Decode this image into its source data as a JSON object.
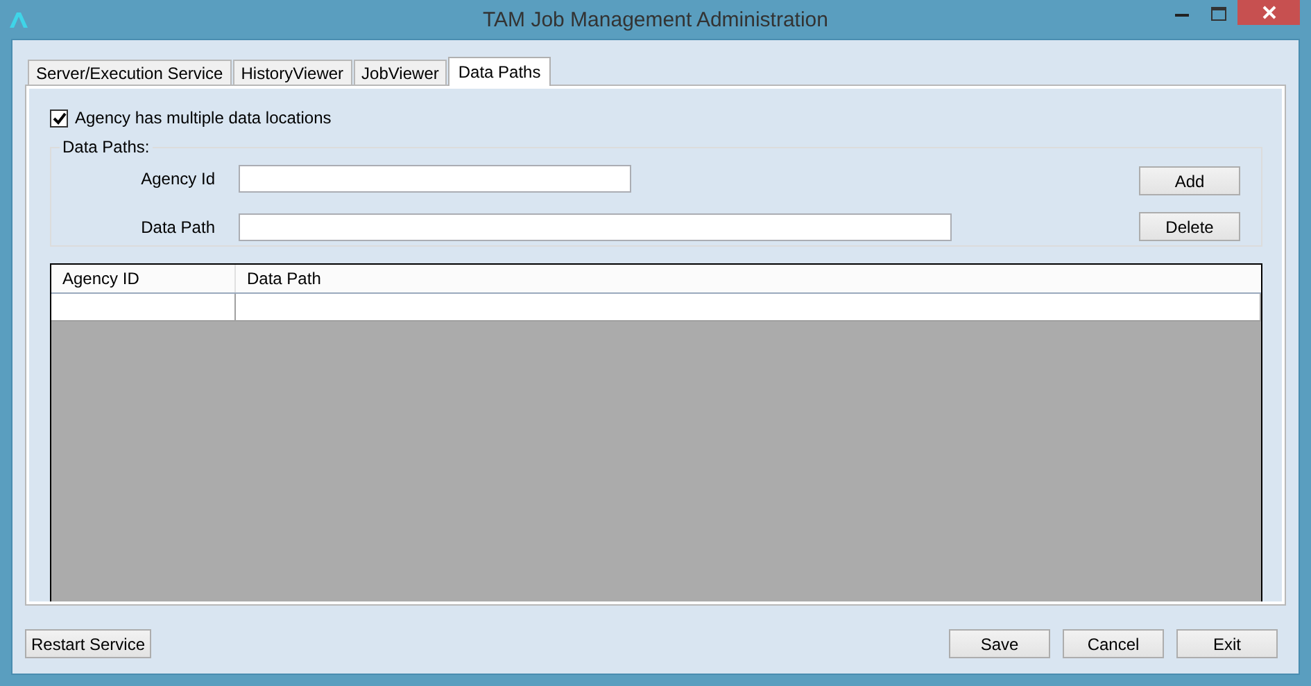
{
  "window": {
    "title": "TAM Job Management Administration"
  },
  "tabs": [
    {
      "label": "Server/Execution Service",
      "selected": false
    },
    {
      "label": "HistoryViewer",
      "selected": false
    },
    {
      "label": "JobViewer",
      "selected": false
    },
    {
      "label": "Data Paths",
      "selected": true
    }
  ],
  "multiple_locations": {
    "label": "Agency has multiple data locations",
    "checked": true
  },
  "data_paths_group": {
    "title": "Data Paths:",
    "agency_id_label": "Agency Id",
    "data_path_label": "Data Path",
    "add_button": "Add",
    "delete_button": "Delete"
  },
  "table": {
    "columns": [
      "Agency ID",
      "Data Path"
    ]
  },
  "buttons": {
    "restart": "Restart Service",
    "save": "Save",
    "cancel": "Cancel",
    "exit": "Exit"
  }
}
